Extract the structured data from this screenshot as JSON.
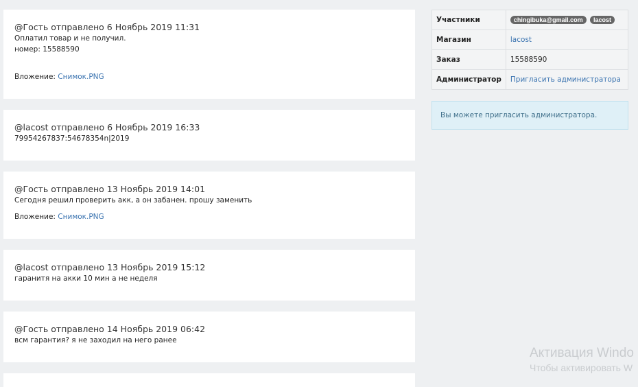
{
  "messages": [
    {
      "header": "@Гость отправлено 6 Ноябрь 2019 11:31",
      "lines": [
        "Оплатил товар и не получил.",
        "номер: 15588590"
      ],
      "attachment_label": "Вложение:",
      "attachment_link": "Снимок.PNG"
    },
    {
      "header": "@lacost отправлено 6 Ноябрь 2019 16:33",
      "lines": [
        "79954267837:54678354n|2019"
      ]
    },
    {
      "header": "@Гость отправлено 13 Ноябрь 2019 14:01",
      "lines": [
        "Сегодня решил проверить акк, а он забанен. прошу заменить"
      ],
      "attachment_label": "Вложение:",
      "attachment_link": "Снимок.PNG"
    },
    {
      "header": "@lacost отправлено 13 Ноябрь 2019 15:12",
      "lines": [
        "гаранитя на акки 10 мин а не неделя"
      ]
    },
    {
      "header": "@Гость отправлено 14 Ноябрь 2019 06:42",
      "lines": [
        "всм гарантия? я не заходил на него ранее"
      ]
    }
  ],
  "info": {
    "participants_label": "Участники",
    "participants": [
      "chingibuka@gmail.com",
      "lacost"
    ],
    "shop_label": "Магазин",
    "shop_value": "lacost",
    "order_label": "Заказ",
    "order_value": "15588590",
    "admin_label": "Администратор",
    "admin_value": "Пригласить администратора"
  },
  "notice": "Вы можете пригласить администратора.",
  "watermark": {
    "line1": "Активация Windo",
    "line2": "Чтобы активировать W"
  },
  "colors": {
    "link": "#3a73b0",
    "badge": "#666666",
    "notice_bg": "#dff0f7",
    "page_bg": "#eef0f2"
  }
}
